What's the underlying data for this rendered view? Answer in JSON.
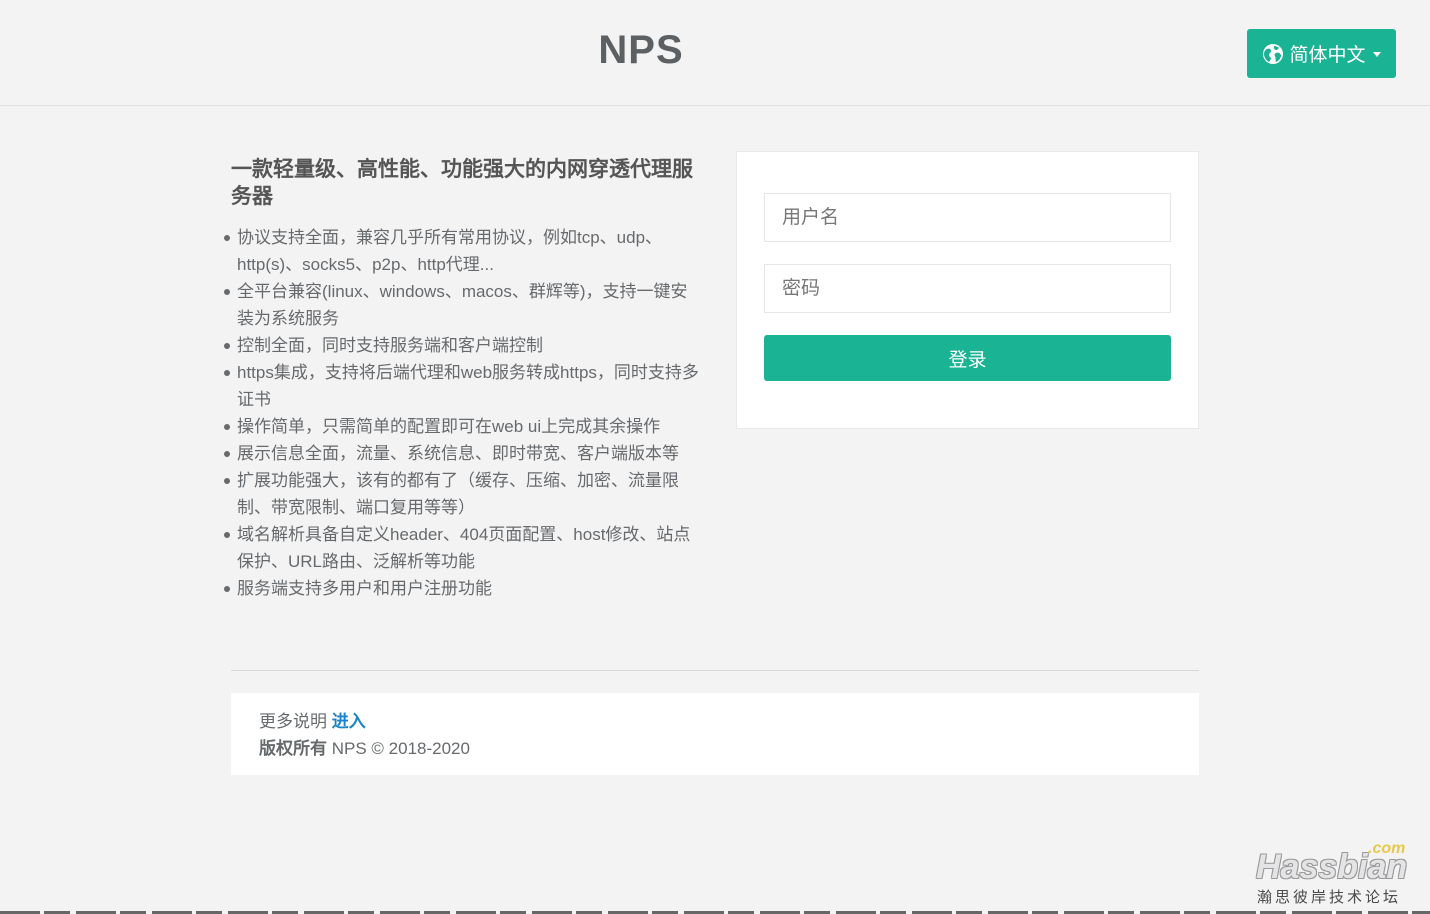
{
  "header": {
    "brand": "NPS",
    "language_button": "简体中文"
  },
  "intro": {
    "heading": "一款轻量级、高性能、功能强大的内网穿透代理服务器",
    "features": [
      "协议支持全面，兼容几乎所有常用协议，例如tcp、udp、http(s)、socks5、p2p、http代理...",
      "全平台兼容(linux、windows、macos、群辉等)，支持一键安装为系统服务",
      "控制全面，同时支持服务端和客户端控制",
      "https集成，支持将后端代理和web服务转成https，同时支持多证书",
      "操作简单，只需简单的配置即可在web ui上完成其余操作",
      "展示信息全面，流量、系统信息、即时带宽、客户端版本等",
      "扩展功能强大，该有的都有了（缓存、压缩、加密、流量限制、带宽限制、端口复用等等）",
      "域名解析具备自定义header、404页面配置、host修改、站点保护、URL路由、泛解析等功能",
      "服务端支持多用户和用户注册功能"
    ]
  },
  "login": {
    "username_placeholder": "用户名",
    "password_placeholder": "密码",
    "submit_label": "登录"
  },
  "footer": {
    "more_label": "更多说明",
    "more_link": "进入",
    "copyright_label": "版权所有",
    "copyright_text": "NPS © 2018-2020"
  },
  "watermark": {
    "main": "Hassbian",
    "com": ".com",
    "sub": "瀚思彼岸技术论坛"
  },
  "colors": {
    "accent": "#1ab394",
    "link": "#1c84c6",
    "background": "#f3f3f4",
    "text": "#676a6c"
  },
  "icons": {
    "language": "globe-icon",
    "dropdown": "caret-down-icon"
  }
}
